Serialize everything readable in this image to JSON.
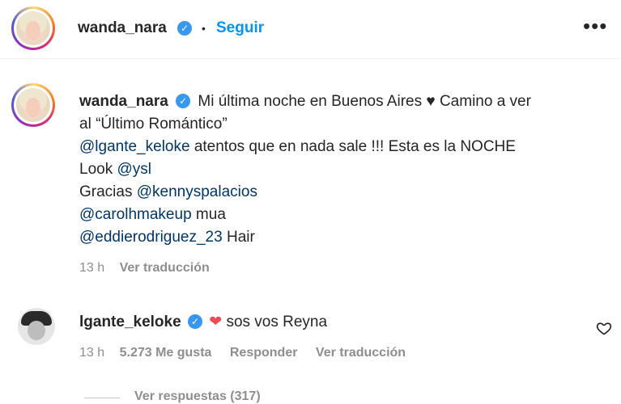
{
  "header": {
    "username": "wanda_nara",
    "separator": "•",
    "follow_label": "Seguir",
    "more_icon": "more-options-icon"
  },
  "caption": {
    "username": "wanda_nara",
    "line1": "Mi última noche en Buenos Aires",
    "line1b": "Camino a ver",
    "line2": "al “Último Romántico”",
    "line3_mention": "@lgante_keloke",
    "line3_text": " atentos que en nada sale !!! Esta es la NOCHE",
    "line4_text": "Look ",
    "line4_mention": "@ysl",
    "line5_text": "Gracias ",
    "line5_mention": "@kennyspalacios",
    "line6_mention": "@carolhmakeup",
    "line6_text": " mua",
    "line7_mention": "@eddierodriguez_23",
    "line7_text": " Hair",
    "time": "13 h",
    "translate": "Ver traducción"
  },
  "comment": {
    "username": "lgante_keloke",
    "text": "sos vos Reyna",
    "time": "13 h",
    "likes": "5.273 Me gusta",
    "reply": "Responder",
    "translate": "Ver traducción",
    "replies": "Ver respuestas (317)"
  },
  "colors": {
    "link_blue": "#0095f6",
    "mention": "#00376b",
    "verified": "#3897f0",
    "heart_red": "#ed4956"
  }
}
